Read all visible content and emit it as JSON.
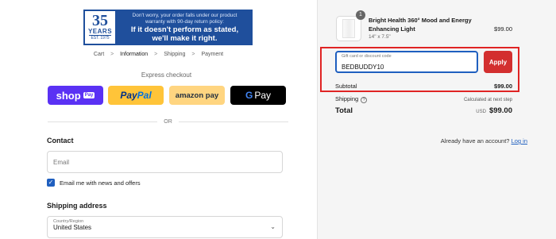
{
  "banner": {
    "badge_number": "35",
    "badge_years": "YEARS",
    "badge_est": "EST. 1975",
    "line1": "Don't worry, your order falls under our product",
    "line2": "warranty with 90-day return policy:",
    "line3": "If it doesn't perform as stated,",
    "line4": "we'll make it right."
  },
  "breadcrumb": {
    "items": [
      "Cart",
      "Information",
      "Shipping",
      "Payment"
    ],
    "separator": ">"
  },
  "express_checkout": {
    "label": "Express checkout",
    "shop": "shop",
    "shop_badge": "Pay",
    "paypal_a": "Pay",
    "paypal_b": "Pal",
    "amazon": "amazon pay",
    "gpay_g": "G",
    "gpay": "Pay"
  },
  "divider": "OR",
  "contact": {
    "heading": "Contact",
    "account_prompt": "Already have an account?",
    "login_link": "Log in",
    "email_placeholder": "Email",
    "newsletter_check": "✓",
    "newsletter_label": "Email me with news and offers"
  },
  "shipping_address": {
    "heading": "Shipping address",
    "country_label": "Country/Region",
    "country_value": "United States",
    "chevron": "⌄"
  },
  "summary": {
    "item": {
      "quantity": "1",
      "name": "Bright Health 360° Mood and Energy Enhancing Light",
      "variant": "14\" x 7.5\"",
      "price": "$99.00"
    },
    "discount": {
      "label": "Gift card or discount code",
      "value": "BEDBUDDY10",
      "apply": "Apply"
    },
    "subtotal_label": "Subtotal",
    "subtotal_value": "$99.00",
    "shipping_label": "Shipping",
    "shipping_help": "?",
    "shipping_value": "Calculated at next step",
    "total_label": "Total",
    "total_currency": "USD",
    "total_value": "$99.00"
  },
  "colors": {
    "accent_blue": "#1f5fbf",
    "apply_red": "#d32f2f",
    "highlight_red": "#e02424",
    "shop_purple": "#5a31f4",
    "paypal_yellow": "#ffc439"
  }
}
